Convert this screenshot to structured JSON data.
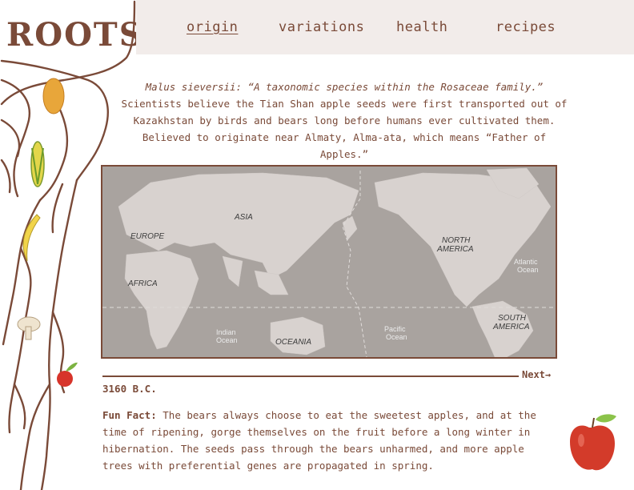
{
  "logo": {
    "text": "ROOTS"
  },
  "nav": {
    "items": [
      {
        "label": "origin",
        "active": true
      },
      {
        "label": "variations",
        "active": false
      },
      {
        "label": "health",
        "active": false
      },
      {
        "label": "recipes",
        "active": false
      }
    ]
  },
  "intro": {
    "quote": "Malus sieversii: “A taxonomic species within the Rosaceae family.”",
    "line1": "Scientists believe the Tian Shan apple seeds were first transported out of",
    "line2": "Kazakhstan by birds and bears long before humans ever cultivated them.",
    "line3": "Believed to originate near Almaty, Alma-ata, which means “Father of Apples.”"
  },
  "map": {
    "labels": {
      "europe": "EUROPE",
      "asia": "ASIA",
      "africa": "AFRICA",
      "oceania": "OCEANIA",
      "north_america_1": "NORTH",
      "north_america_2": "AMERICA",
      "south_america_1": "SOUTH",
      "south_america_2": "AMERICA"
    },
    "oceans": {
      "atlantic_1": "Atlantic",
      "atlantic_2": "Ocean",
      "indian_1": "Indian",
      "indian_2": "Ocean",
      "pacific_1": "Pacific",
      "pacific_2": "Ocean"
    },
    "colors": {
      "land": "#d8d2cf",
      "water": "#a9a39f"
    }
  },
  "timeline": {
    "next_label": "Next",
    "year": "3160 B.C."
  },
  "funfact": {
    "title": "Fun Fact:",
    "body": "The bears always choose to eat the sweetest apples, and at the time of ripening, gorge themselves on the fruit before a long winter in hibernation. The seeds pass through the bears unharmed, and more apple trees with preferential genes are propagated in spring."
  },
  "colors": {
    "brown": "#7a4a38",
    "header_bg": "#f2ecea"
  }
}
